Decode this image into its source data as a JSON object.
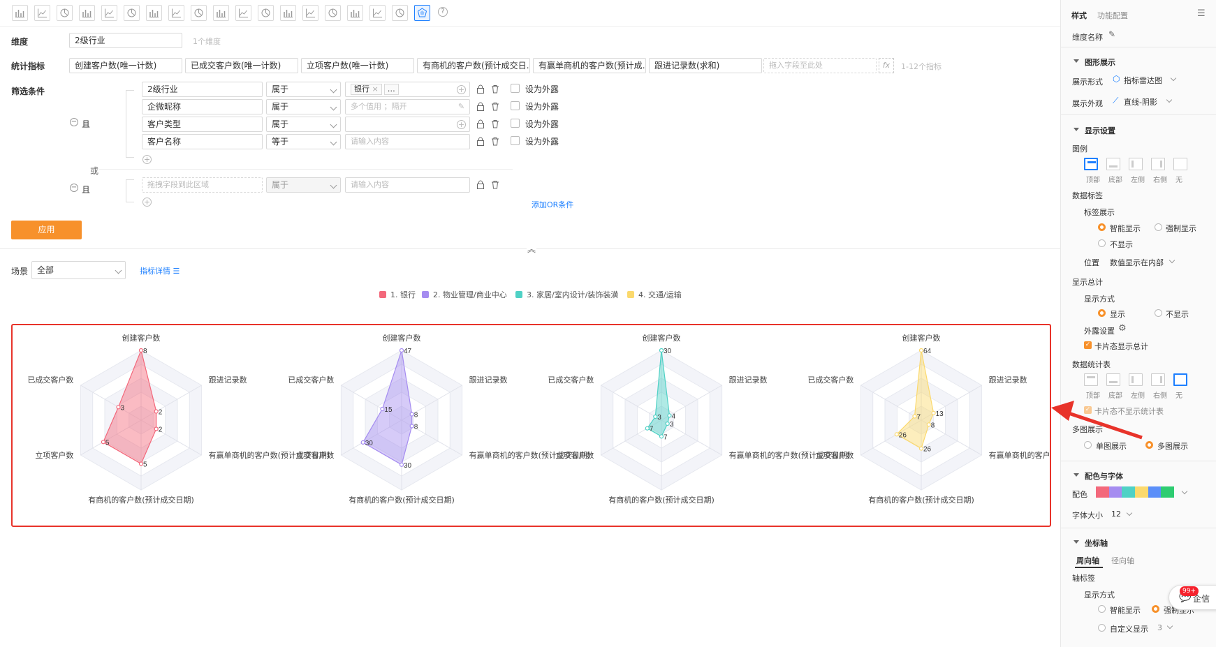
{
  "toolbar": {
    "chart_types": [
      "bar-chart-icon",
      "line-chart-icon",
      "pie-chart-icon",
      "funnel-icon",
      "funnel-alt-icon",
      "table-icon",
      "combo-chart-icon",
      "card-icon",
      "gauge-icon",
      "map-icon",
      "map-alt-icon",
      "world-map-icon",
      "ring-icon",
      "histogram-icon",
      "area-chart-icon",
      "pivot-icon",
      "detail-table-icon",
      "scatter-icon",
      "radar-chart-icon"
    ],
    "active_index": 18
  },
  "dimension": {
    "label": "维度",
    "value": "2级行业",
    "hint": "1个维度"
  },
  "metrics": {
    "label": "统计指标",
    "items": [
      "创建客户数(唯一计数)",
      "已成交客户数(唯一计数)",
      "立项客户数(唯一计数)",
      "有商机的客户数(预计成交日…",
      "有赢单商机的客户数(预计成…",
      "跟进记录数(求和)"
    ],
    "drop_placeholder": "拖入字段至此处",
    "fx": "fx",
    "hint": "1-12个指标"
  },
  "filter": {
    "label": "筛选条件",
    "and_label": "且",
    "or_label": "或",
    "rows": [
      {
        "field": "2级行业",
        "op": "属于",
        "tag": "银行",
        "more": "…",
        "expose": "设为外露"
      },
      {
        "field": "企微昵称",
        "op": "属于",
        "placeholder": "多个值用 ；隔开",
        "expose": "设为外露"
      },
      {
        "field": "客户类型",
        "op": "属于",
        "placeholder": "",
        "expose": "设为外露"
      },
      {
        "field": "客户名称",
        "op": "等于",
        "placeholder": "请输入内容",
        "expose": "设为外露"
      }
    ],
    "second_group": {
      "field_placeholder": "拖拽字段到此区域",
      "op": "属于",
      "placeholder": "请输入内容"
    },
    "add_or": "添加OR条件",
    "apply": "应用"
  },
  "scene": {
    "label": "场景",
    "value": "全部",
    "detail_link": "指标详情"
  },
  "legend": [
    {
      "label": "1. 银行",
      "color": "#f3687b"
    },
    {
      "label": "2. 物业管理/商业中心",
      "color": "#a58cf0"
    },
    {
      "label": "3. 家居/室内设计/装饰装潢",
      "color": "#4fd1c5"
    },
    {
      "label": "4. 交通/运输",
      "color": "#fbd96d"
    }
  ],
  "chart_data": {
    "type": "radar",
    "indicators": [
      "创建客户数",
      "跟进记录数",
      "有赢单商机的客户数(预计成交日期)",
      "有商机的客户数(预计成交日期)",
      "立项客户数",
      "已成交客户数"
    ],
    "series": [
      {
        "name": "1. 银行",
        "values": [
          8,
          2,
          2,
          5,
          5,
          3
        ],
        "color": "#f3687b"
      },
      {
        "name": "2. 物业管理/商业中心",
        "values": [
          47,
          8,
          8,
          30,
          30,
          15
        ],
        "color": "#a58cf0"
      },
      {
        "name": "3. 家居/室内设计/装饰装潢",
        "values": [
          30,
          4,
          3,
          7,
          7,
          3
        ],
        "color": "#4fd1c5"
      },
      {
        "name": "4. 交通/运输",
        "values": [
          64,
          13,
          8,
          26,
          26,
          7
        ],
        "color": "#fbd96d"
      }
    ]
  },
  "right_panel": {
    "tabs": [
      "样式",
      "功能配置"
    ],
    "dim_name_label": "维度名称",
    "section_chart": "图形展示",
    "form_label": "展示形式",
    "form_value": "指标雷达图",
    "look_label": "展示外观",
    "look_value": "直线-阴影",
    "section_display": "显示设置",
    "legend_label": "图例",
    "positions": [
      "顶部",
      "底部",
      "左侧",
      "右侧",
      "无"
    ],
    "data_label": "数据标签",
    "label_show": "标签展示",
    "smart_show": "智能显示",
    "force_show": "强制显示",
    "no_show": "不显示",
    "position_label": "位置",
    "position_value": "数值显示在内部",
    "total_label": "显示总计",
    "show_way": "显示方式",
    "show": "显示",
    "hide": "不显示",
    "expose_settings": "外露设置",
    "card_total": "卡片态显示总计",
    "stats_table": "数据统计表",
    "card_no_stats": "卡片态不显示统计表",
    "multi_show": "多图展示",
    "single_display": "单图展示",
    "multi_display": "多图展示",
    "section_color": "配色与字体",
    "palette_label": "配色",
    "palette": [
      "#f3687b",
      "#a58cf0",
      "#4fd1c5",
      "#fbd96d",
      "#5b8ff9",
      "#2ecc71"
    ],
    "font_size_label": "字体大小",
    "font_size": "12",
    "section_axis": "坐标轴",
    "axis_tabs": [
      "周向轴",
      "径向轴"
    ],
    "axis_label": "轴标签",
    "axis_show_way": "显示方式",
    "axis_smart": "智能显示",
    "axis_force": "强制显示",
    "axis_custom": "自定义显示",
    "axis_custom_value": "3",
    "qixin": "企信",
    "qixin_badge": "99+"
  }
}
